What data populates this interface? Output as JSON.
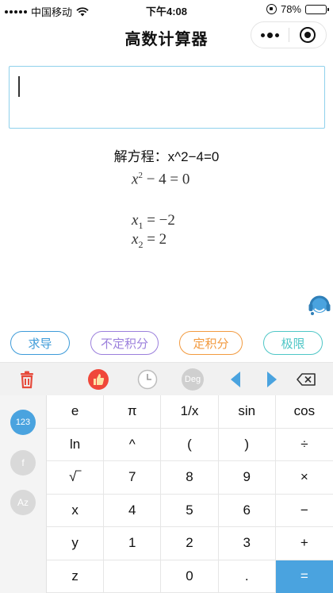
{
  "status_bar": {
    "carrier": "中国移动",
    "time": "下午4:08",
    "battery": "78%",
    "battery_level": 0.78
  },
  "nav": {
    "title": "高数计算器"
  },
  "input": {
    "value": ""
  },
  "result": {
    "title": "解方程：x^2−4=0",
    "equation": {
      "base": "x",
      "exp": "2",
      "rest": " − 4 = 0"
    },
    "solutions": [
      {
        "var": "x",
        "sub": "1",
        "rest": " = −2"
      },
      {
        "var": "x",
        "sub": "2",
        "rest": " = 2"
      }
    ]
  },
  "operations": [
    {
      "label": "求导",
      "color": "#3d9bd9"
    },
    {
      "label": "不定积分",
      "color": "#9b7fdc"
    },
    {
      "label": "定积分",
      "color": "#f29a3f"
    },
    {
      "label": "极限",
      "color": "#4ec6c6"
    }
  ],
  "toolbar": {
    "deg_label": "Deg",
    "colors": {
      "delete": "#e64a3b",
      "like": "#f0483a",
      "arrows": "#4aa3df"
    }
  },
  "side_modes": [
    "123",
    "f",
    "Az"
  ],
  "keys": [
    [
      "e",
      "π",
      "1/x",
      "sin",
      "cos"
    ],
    [
      "ln",
      "^",
      "(",
      ")",
      "÷"
    ],
    [
      "√‾",
      "7",
      "8",
      "9",
      "×"
    ],
    [
      "x",
      "4",
      "5",
      "6",
      "−"
    ],
    [
      "y",
      "1",
      "2",
      "3",
      "+"
    ],
    [
      "z",
      "",
      "0",
      ".",
      "="
    ]
  ]
}
